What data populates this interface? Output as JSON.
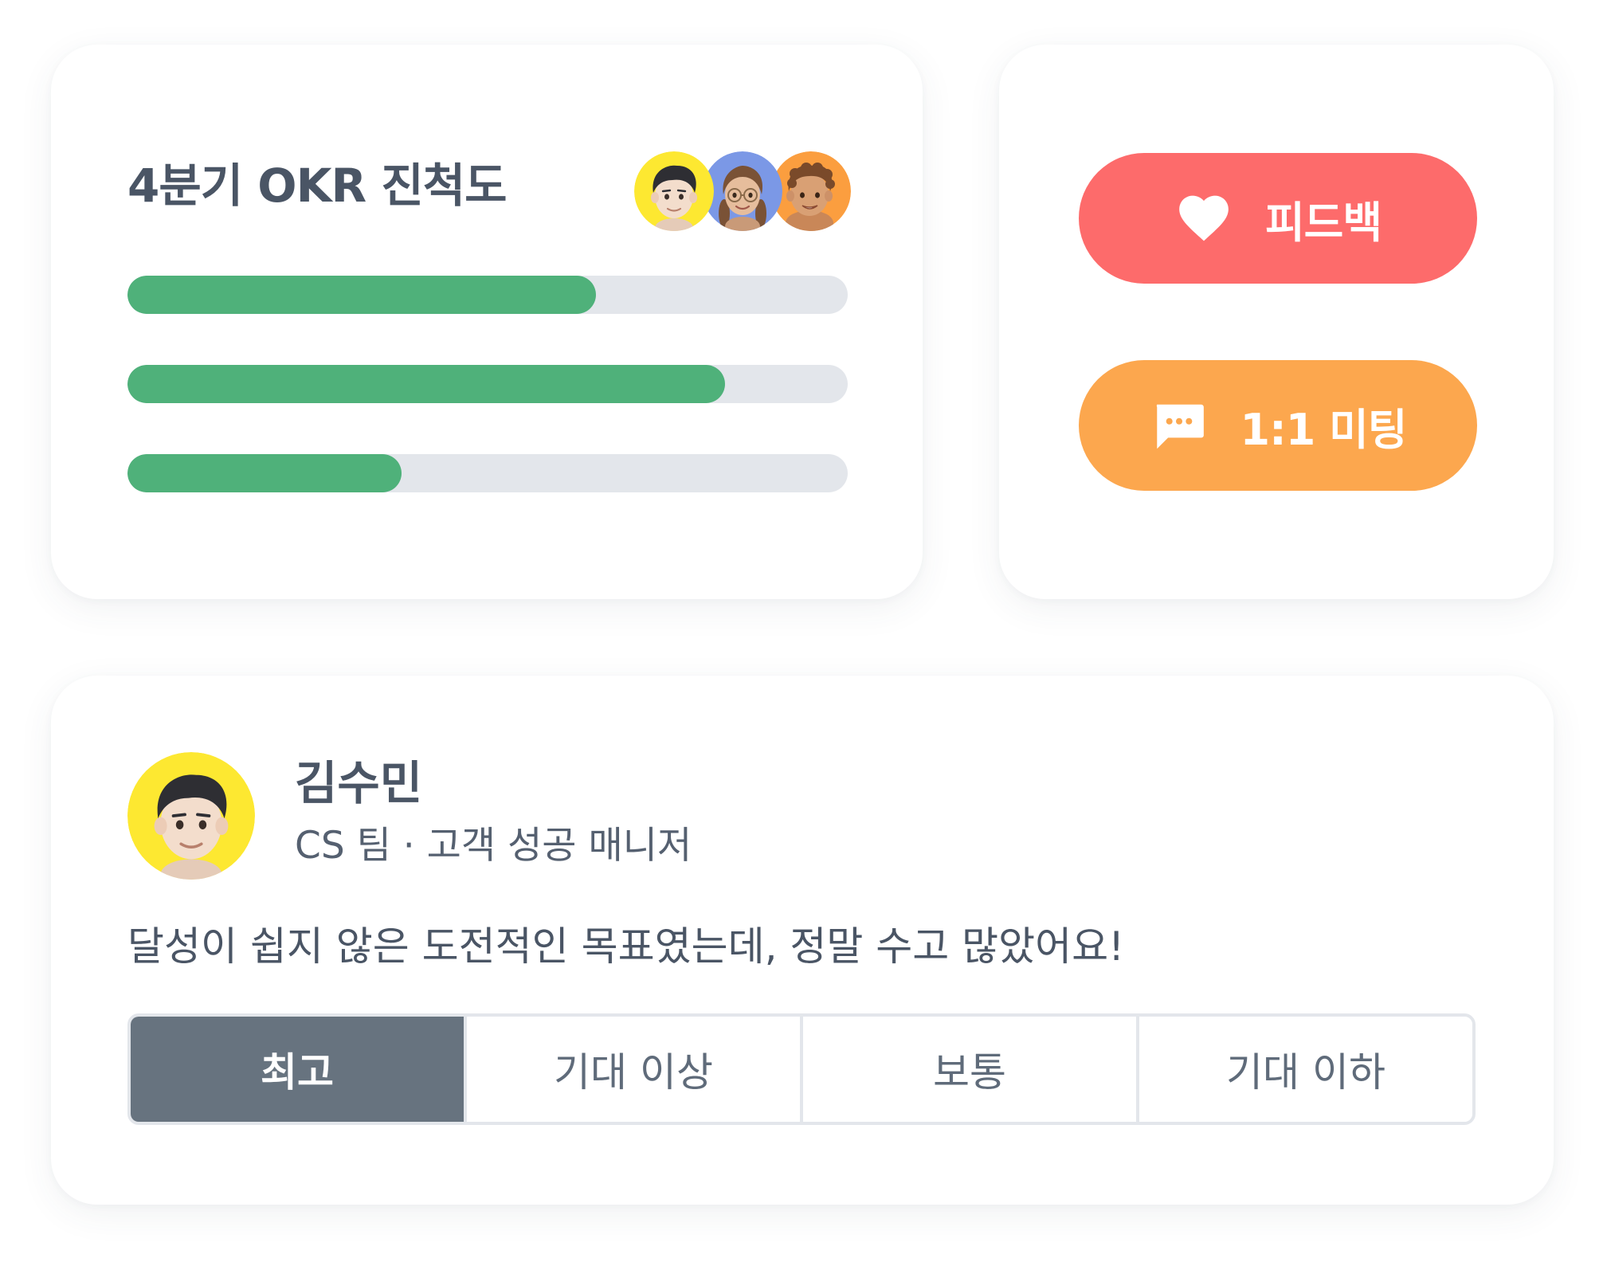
{
  "okr_card": {
    "title": "4분기 OKR 진척도",
    "participants": [
      "memoji-boy-avatar",
      "memoji-girl-glasses-avatar",
      "memoji-curly-boy-avatar"
    ],
    "progress": [
      {
        "value": 0.65
      },
      {
        "value": 0.83
      },
      {
        "value": 0.38
      }
    ]
  },
  "actions": {
    "feedback": {
      "label": "피드백",
      "icon": "heart-icon",
      "color": "#fd6b6b"
    },
    "meeting": {
      "label": "1:1 미팅",
      "icon": "chat-bubble-icon",
      "color": "#fca74e"
    }
  },
  "review": {
    "name": "김수민",
    "role": "CS 팀 · 고객 성공 매니저",
    "comment": "달성이 쉽지 않은 도전적인 목표였는데, 정말 수고 많았어요!",
    "ratings": [
      "최고",
      "기대 이상",
      "보통",
      "기대 이하"
    ],
    "selected_rating": "최고"
  },
  "colors": {
    "progress_fill": "#4fb17a",
    "progress_track": "#e3e6eb",
    "text_primary": "#4a5565",
    "selected_rating_bg": "#67737f"
  }
}
